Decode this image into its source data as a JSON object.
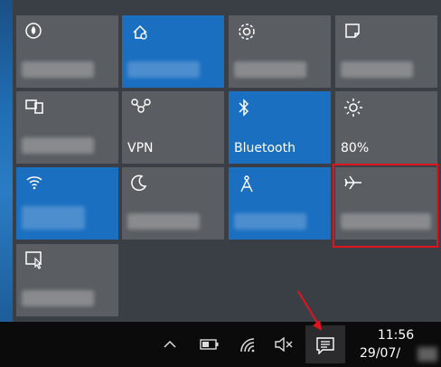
{
  "quick_actions": {
    "vpn_label": "VPN",
    "bluetooth_label": "Bluetooth",
    "brightness_label": "80%"
  },
  "taskbar": {
    "time": "11:56",
    "date": "29/07/"
  },
  "icons": {
    "tablet_mode": "tablet-mode-icon",
    "location": "location-icon",
    "settings": "gear-icon",
    "note": "note-icon",
    "project": "project-icon",
    "vpn": "vpn-icon",
    "bluetooth": "bluetooth-icon",
    "brightness": "sun-icon",
    "wifi": "wifi-icon",
    "quiet_hours": "moon-icon",
    "mobile_hotspot": "hotspot-icon",
    "airplane_mode": "airplane-icon",
    "connect": "connect-icon"
  },
  "colors": {
    "tile_on": "#1b6fc1",
    "tile_off": "#5a5e62",
    "highlight": "#e0141e"
  }
}
